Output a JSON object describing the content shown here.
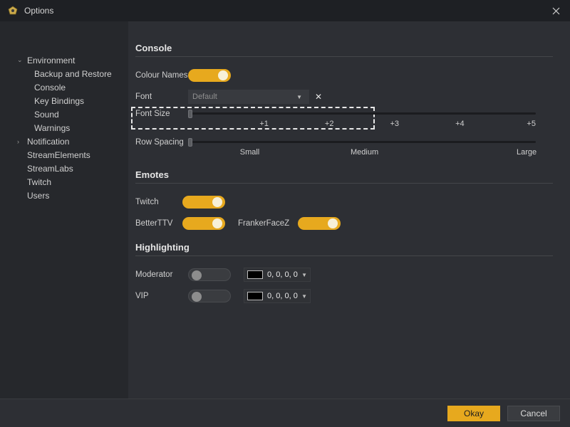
{
  "window": {
    "title": "Options"
  },
  "sidebar": {
    "items": [
      {
        "label": "Environment",
        "level": 1,
        "expand": "open"
      },
      {
        "label": "Backup and Restore",
        "level": 2
      },
      {
        "label": "Console",
        "level": 2
      },
      {
        "label": "Key Bindings",
        "level": 2
      },
      {
        "label": "Sound",
        "level": 2
      },
      {
        "label": "Warnings",
        "level": 2
      },
      {
        "label": "Notification",
        "level": 1,
        "expand": "closed"
      },
      {
        "label": "StreamElements",
        "level": 1
      },
      {
        "label": "StreamLabs",
        "level": 1
      },
      {
        "label": "Twitch",
        "level": 1
      },
      {
        "label": "Users",
        "level": 1
      }
    ]
  },
  "sections": {
    "console": {
      "title": "Console",
      "colour_names_label": "Colour Names",
      "colour_names_on": true,
      "font_label": "Font",
      "font_value": "Default",
      "font_size_label": "Font Size",
      "font_size_ticks": [
        "",
        "+1",
        "+2",
        "+3",
        "+4",
        "+5"
      ],
      "font_size_value": 0,
      "row_spacing_label": "Row Spacing",
      "row_spacing_ticks": [
        "Small",
        "Medium",
        "Large"
      ],
      "row_spacing_value": 0
    },
    "emotes": {
      "title": "Emotes",
      "twitch_label": "Twitch",
      "twitch_on": true,
      "betterttv_label": "BetterTTV",
      "betterttv_on": true,
      "ffz_label": "FrankerFaceZ",
      "ffz_on": true
    },
    "highlighting": {
      "title": "Highlighting",
      "moderator_label": "Moderator",
      "moderator_on": false,
      "moderator_color": "0, 0, 0, 0",
      "vip_label": "VIP",
      "vip_on": false,
      "vip_color": "0, 0, 0, 0"
    }
  },
  "footer": {
    "okay": "Okay",
    "cancel": "Cancel"
  }
}
